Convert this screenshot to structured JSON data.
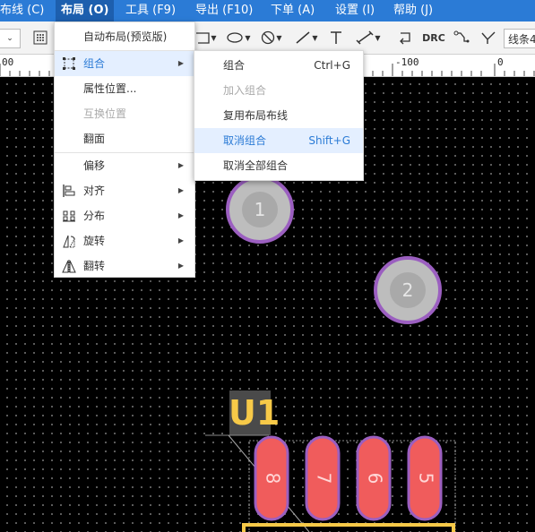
{
  "menubar": {
    "items": [
      {
        "label": "布线 (C)"
      },
      {
        "label": "布局 (O)"
      },
      {
        "label": "工具 (F9)"
      },
      {
        "label": "导出 (F10)"
      },
      {
        "label": "下单 (A)"
      },
      {
        "label": "设置 (I)"
      },
      {
        "label": "帮助 (J)"
      }
    ],
    "active_color": "#1d5fae",
    "bar_color": "#2b7bd6"
  },
  "toolbar": {
    "drc_label": "DRC",
    "line_label": "线条4"
  },
  "ruler": {
    "labels": [
      "00",
      "-100",
      "0"
    ]
  },
  "layout_menu": {
    "items": [
      {
        "label": "自动布局(预览版)"
      },
      {
        "label": "组合",
        "icon": "group-icon",
        "submenu": true
      },
      {
        "label": "属性位置..."
      },
      {
        "label": "互换位置",
        "disabled": true
      },
      {
        "label": "翻面"
      },
      {
        "label": "偏移",
        "submenu": true
      },
      {
        "label": "对齐",
        "icon": "align-icon",
        "submenu": true
      },
      {
        "label": "分布",
        "icon": "distribute-icon",
        "submenu": true
      },
      {
        "label": "旋转",
        "icon": "rotate-icon",
        "submenu": true
      },
      {
        "label": "翻转",
        "icon": "flip-icon",
        "submenu": true
      }
    ]
  },
  "group_submenu": {
    "items": [
      {
        "label": "组合",
        "shortcut": "Ctrl+G"
      },
      {
        "label": "加入组合",
        "disabled": true
      },
      {
        "label": "复用布局布线"
      },
      {
        "label": "取消组合",
        "shortcut": "Shift+G",
        "highlighted": true
      },
      {
        "label": "取消全部组合"
      }
    ]
  },
  "pcb": {
    "pad1_label": "1",
    "pad2_label": "2",
    "designator": "U1",
    "smd_pads": [
      "8",
      "7",
      "6",
      "5"
    ],
    "pad_color": "#f05c5c",
    "outline_color": "#9b5fc0",
    "silk_color": "#ffd54a"
  }
}
